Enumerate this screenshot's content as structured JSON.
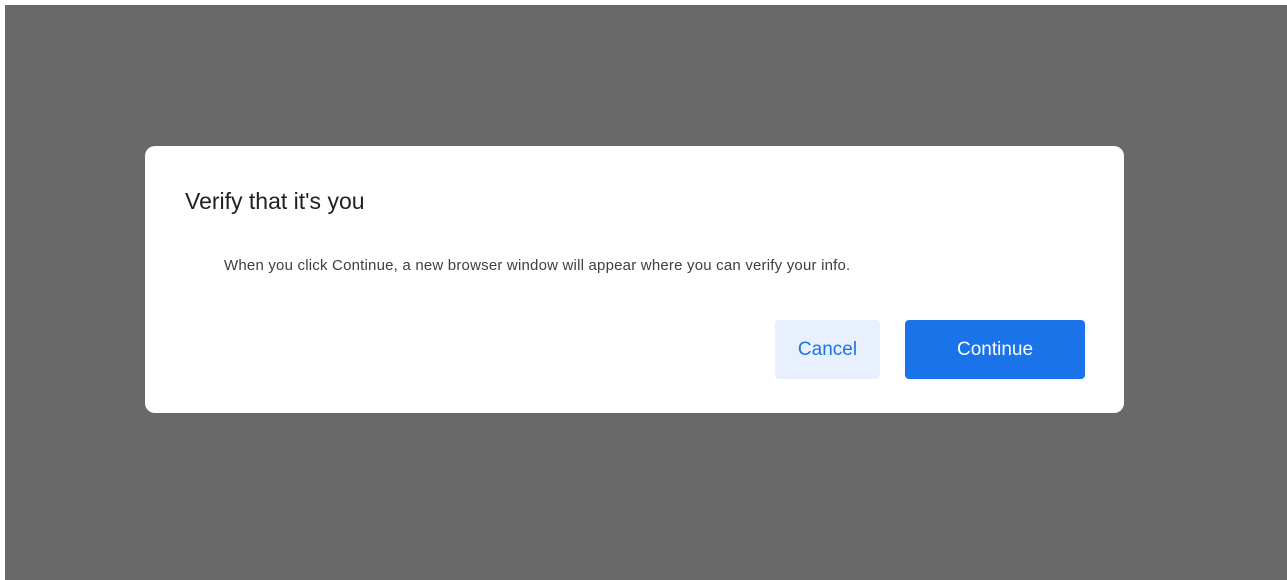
{
  "dialog": {
    "title": "Verify that it's you",
    "message": "When you click Continue, a new browser window will appear where you can verify your info.",
    "cancel_label": "Cancel",
    "continue_label": "Continue"
  },
  "colors": {
    "overlay": "#696969",
    "dialog_background": "#ffffff",
    "primary": "#1a73e8",
    "secondary_background": "#e8f0fe",
    "text": "#202124"
  }
}
